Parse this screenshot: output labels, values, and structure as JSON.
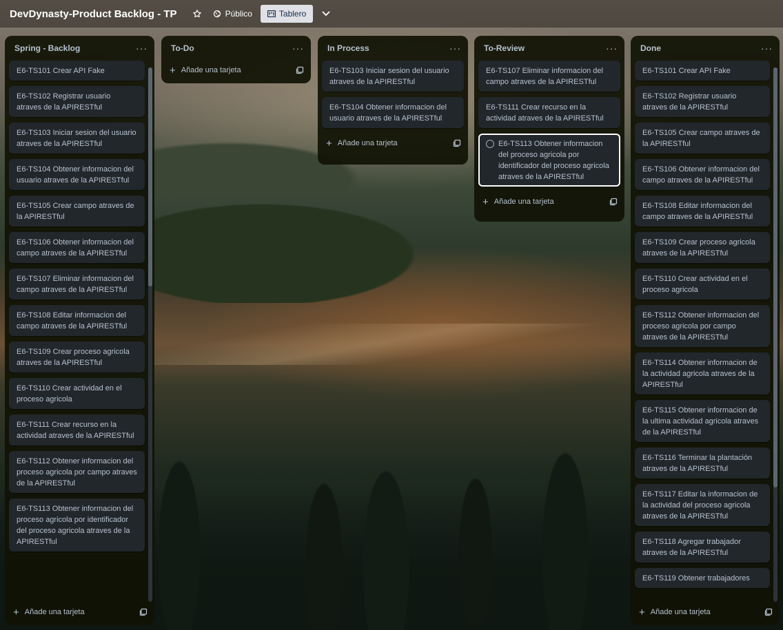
{
  "header": {
    "board_title": "DevDynasty-Product Backlog - TP",
    "visibility_label": "Público",
    "view_label": "Tablero"
  },
  "lists": {
    "backlog": {
      "title": "Spring - Backlog",
      "add_label": "Añade una tarjeta",
      "cards": [
        "E6-TS101 Crear API Fake",
        "E6-TS102 Registrar usuario atraves de la APIRESTful",
        "E6-TS103 Iniciar sesion del usuario atraves de la APIRESTful",
        "E6-TS104 Obtener informacion del usuario atraves de la APIRESTful",
        "E6-TS105 Crear campo atraves de la APIRESTful",
        "E6-TS106 Obtener informacion del campo atraves de la APIRESTful",
        "E6-TS107 Eliminar informacion del campo atraves de la APIRESTful",
        "E6-TS108 Editar informacion del campo atraves de la APIRESTful",
        "E6-TS109 Crear proceso agricola atraves de la APIRESTful",
        "E6-TS110 Crear actividad en el proceso agricola",
        "E6-TS111 Crear recurso en la actividad atraves de la APIRESTful",
        "E6-TS112 Obtener informacion del proceso agricola por campo atraves de la APIRESTful",
        "E6-TS113 Obtener informacion del proceso agricola por identificador del proceso agricola atraves de la APIRESTful"
      ]
    },
    "todo": {
      "title": "To-Do",
      "add_label": "Añade una tarjeta",
      "cards": []
    },
    "in_process": {
      "title": "In Process",
      "add_label": "Añade una tarjeta",
      "cards": [
        "E6-TS103 Iniciar sesion del usuario atraves de la APIRESTful",
        "E6-TS104 Obtener informacion del usuario atraves de la APIRESTful"
      ]
    },
    "to_review": {
      "title": "To-Review",
      "add_label": "Añade una tarjeta",
      "cards": [
        "E6-TS107 Eliminar informacion del campo atraves de la APIRESTful",
        "E6-TS111 Crear recurso en la actividad atraves de la APIRESTful",
        "E6-TS113 Obtener informacion del proceso agricola por identificador del proceso agricola atraves de la APIRESTful"
      ]
    },
    "done": {
      "title": "Done",
      "add_label": "Añade una tarjeta",
      "cards": [
        "E6-TS101 Crear API Fake",
        "E6-TS102 Registrar usuario atraves de la APIRESTful",
        "E6-TS105 Crear campo atraves de la APIRESTful",
        "E6-TS106 Obtener informacion del campo atraves de la APIRESTful",
        "E6-TS108 Editar informacion del campo atraves de la APIRESTful",
        "E6-TS109 Crear proceso agricola atraves de la APIRESTful",
        "E6-TS110 Crear actividad en el proceso agricola",
        "E6-TS112 Obtener informacion del proceso agricola por campo atraves de la APIRESTful",
        "E6-TS114 Obtener informacion de la actividad agricola atraves de la APIRESTful",
        "E6-TS115 Obtener informacion de la ultima actividad agricola atraves de la APIRESTful",
        "E6-TS116 Terminar la plantación atraves de la APIRESTful",
        "E6-TS117 Editar la informacion de la actividad del proceso agricola atraves de la APIRESTful",
        "E6-TS118 Agregar trabajador atraves de la APIRESTful",
        "E6-TS119 Obtener trabajadores"
      ]
    }
  }
}
